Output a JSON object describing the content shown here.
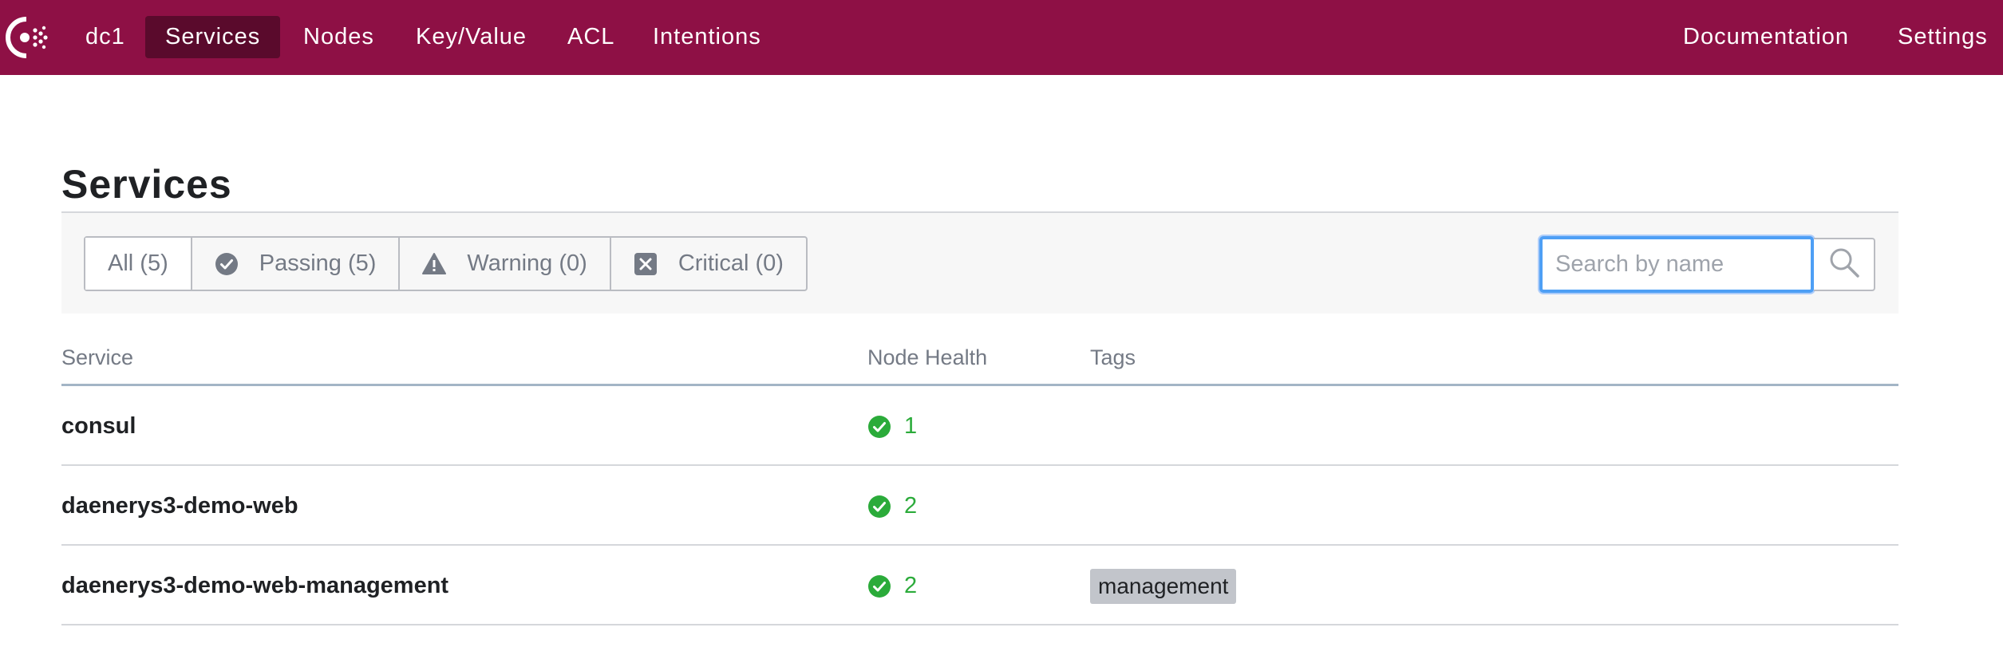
{
  "header": {
    "datacenter": "dc1",
    "nav": [
      {
        "label": "Services",
        "active": true
      },
      {
        "label": "Nodes",
        "active": false
      },
      {
        "label": "Key/Value",
        "active": false
      },
      {
        "label": "ACL",
        "active": false
      },
      {
        "label": "Intentions",
        "active": false
      }
    ],
    "right_nav": [
      {
        "label": "Documentation"
      },
      {
        "label": "Settings"
      }
    ],
    "colors": {
      "brand": "#8e1045",
      "active_tab": "#5a0a2c"
    }
  },
  "page": {
    "title": "Services"
  },
  "filters": {
    "items": [
      {
        "label": "All (5)",
        "icon": "none",
        "active": true
      },
      {
        "label": "Passing (5)",
        "icon": "check-circle-icon",
        "active": false
      },
      {
        "label": "Warning (0)",
        "icon": "warning-triangle-icon",
        "active": false
      },
      {
        "label": "Critical (0)",
        "icon": "x-square-icon",
        "active": false
      }
    ]
  },
  "search": {
    "placeholder": "Search by name",
    "value": ""
  },
  "table": {
    "columns": [
      "Service",
      "Node Health",
      "Tags"
    ],
    "rows": [
      {
        "name": "consul",
        "health": "1",
        "tags": []
      },
      {
        "name": "daenerys3-demo-web",
        "health": "2",
        "tags": []
      },
      {
        "name": "daenerys3-demo-web-management",
        "health": "2",
        "tags": [
          "management"
        ]
      }
    ],
    "colors": {
      "passing": "#2bab3a"
    }
  }
}
